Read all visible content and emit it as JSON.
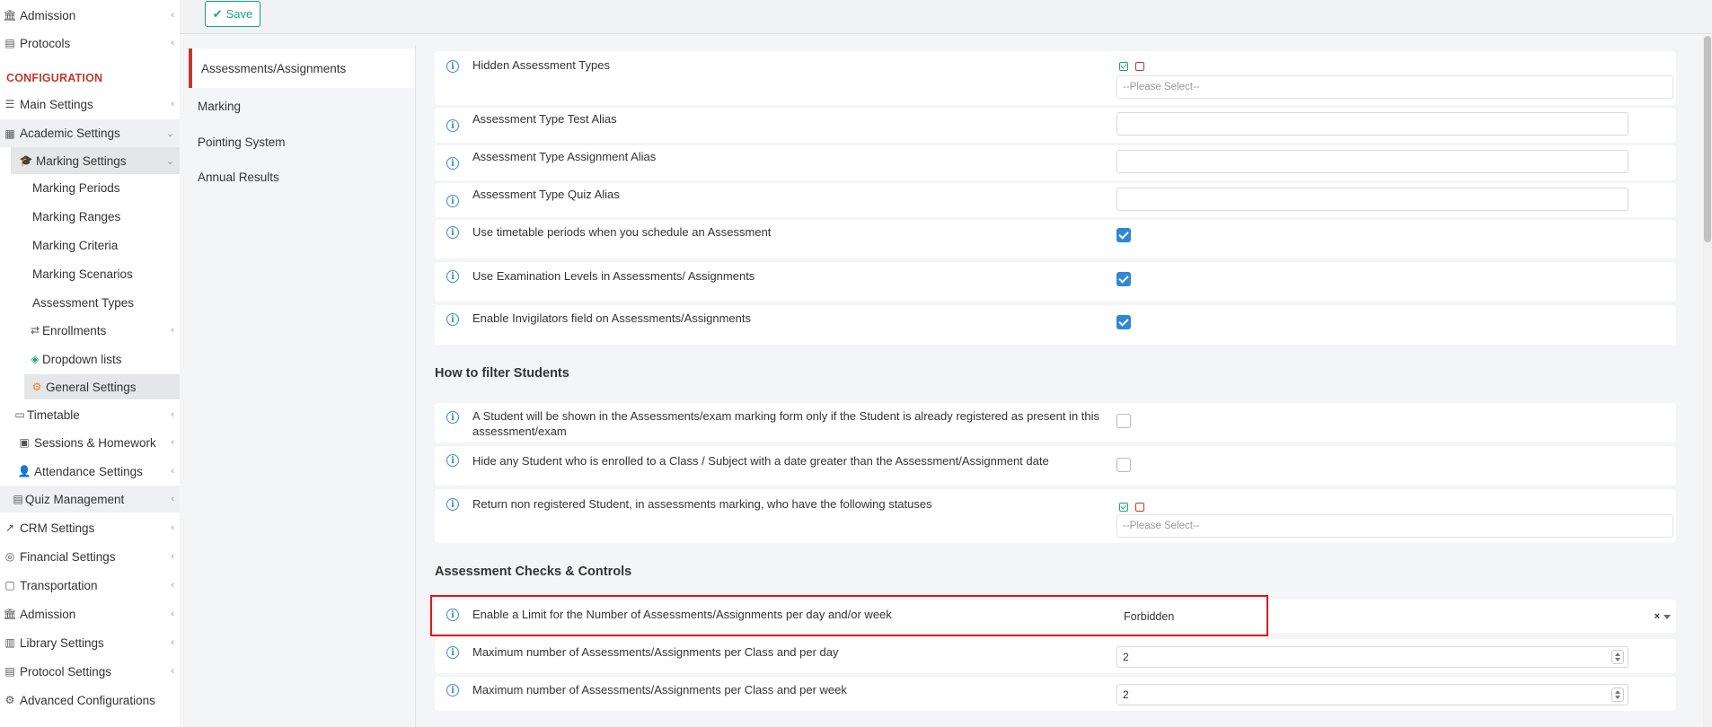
{
  "sidebar": {
    "items": [
      {
        "label": "Admission",
        "icon": "institution-icon"
      },
      {
        "label": "Protocols",
        "icon": "printer-icon"
      },
      {
        "label": "Main Settings",
        "icon": "sliders-icon"
      },
      {
        "label": "Academic Settings",
        "icon": "users-group-icon"
      },
      {
        "label": "Marking Settings",
        "icon": "graduation-cap-icon"
      },
      {
        "label": "Marking Periods"
      },
      {
        "label": "Marking Ranges"
      },
      {
        "label": "Marking Criteria"
      },
      {
        "label": "Marking Scenarios"
      },
      {
        "label": "Assessment Types"
      },
      {
        "label": "Enrollments",
        "icon": "exchange-icon"
      },
      {
        "label": "Dropdown lists",
        "icon": "layers-icon"
      },
      {
        "label": "General Settings",
        "icon": "gear-icon"
      },
      {
        "label": "Timetable",
        "icon": "calendar-icon"
      },
      {
        "label": "Sessions & Homework",
        "icon": "teacher-icon"
      },
      {
        "label": "Attendance Settings",
        "icon": "user-check-icon"
      },
      {
        "label": "Quiz Management",
        "icon": "list-icon"
      },
      {
        "label": "CRM Settings",
        "icon": "chart-line-icon"
      },
      {
        "label": "Financial Settings",
        "icon": "coins-icon"
      },
      {
        "label": "Transportation",
        "icon": "bus-icon"
      },
      {
        "label": "Admission",
        "icon": "institution-icon"
      },
      {
        "label": "Library Settings",
        "icon": "books-icon"
      },
      {
        "label": "Protocol Settings",
        "icon": "printer-icon"
      },
      {
        "label": "Advanced Configurations",
        "icon": "gears-icon"
      }
    ],
    "section_label": "CONFIGURATION",
    "accent_color": "#c0392b"
  },
  "toolbar": {
    "save_label": "Save",
    "save_color": "#1aa37a"
  },
  "inner_menu": [
    "Assessments/Assignments",
    "Marking",
    "Pointing System",
    "Annual Results"
  ],
  "rows": {
    "hidden_types": {
      "label": "Hidden Assessment Types",
      "placeholder": "--Please Select--"
    },
    "test_alias": {
      "label": "Assessment Type Test Alias"
    },
    "assignment_alias": {
      "label": "Assessment Type Assignment Alias"
    },
    "quiz_alias": {
      "label": "Assessment Type Quiz Alias"
    },
    "timetable": {
      "label": "Use timetable periods when you schedule an Assessment",
      "checked": true
    },
    "exam_levels": {
      "label": "Use Examination Levels in Assessments/ Assignments",
      "checked": true
    },
    "invigilators": {
      "label": "Enable Invigilators field on Assessments/Assignments",
      "checked": true
    },
    "registered": {
      "label": "A Student will be shown in the Assessments/exam marking form only if the Student is already registered as present in this assessment/exam",
      "checked": false
    },
    "hide_enrolled": {
      "label": "Hide any Student who is enrolled to a Class / Subject with a date greater than the Assessment/Assignment date",
      "checked": false
    },
    "non_registered": {
      "label": "Return non registered Student, in assessments marking, who have the following statuses",
      "placeholder": "--Please Select--"
    },
    "limit": {
      "label": "Enable a Limit for the Number of Assessments/Assignments per day and/or week",
      "value": "Forbidden",
      "clear": "×"
    },
    "max_day": {
      "label": "Maximum number of Assessments/Assignments per Class and per day",
      "value": "2"
    },
    "max_week": {
      "label": "Maximum number of Assessments/Assignments per Class and per week",
      "value": "2"
    }
  },
  "sections": {
    "filter": "How to filter Students",
    "checks": "Assessment Checks & Controls"
  },
  "checkbox_color": "#2f87d8",
  "highlight_color": "#e0161b",
  "info_glyph": "i"
}
